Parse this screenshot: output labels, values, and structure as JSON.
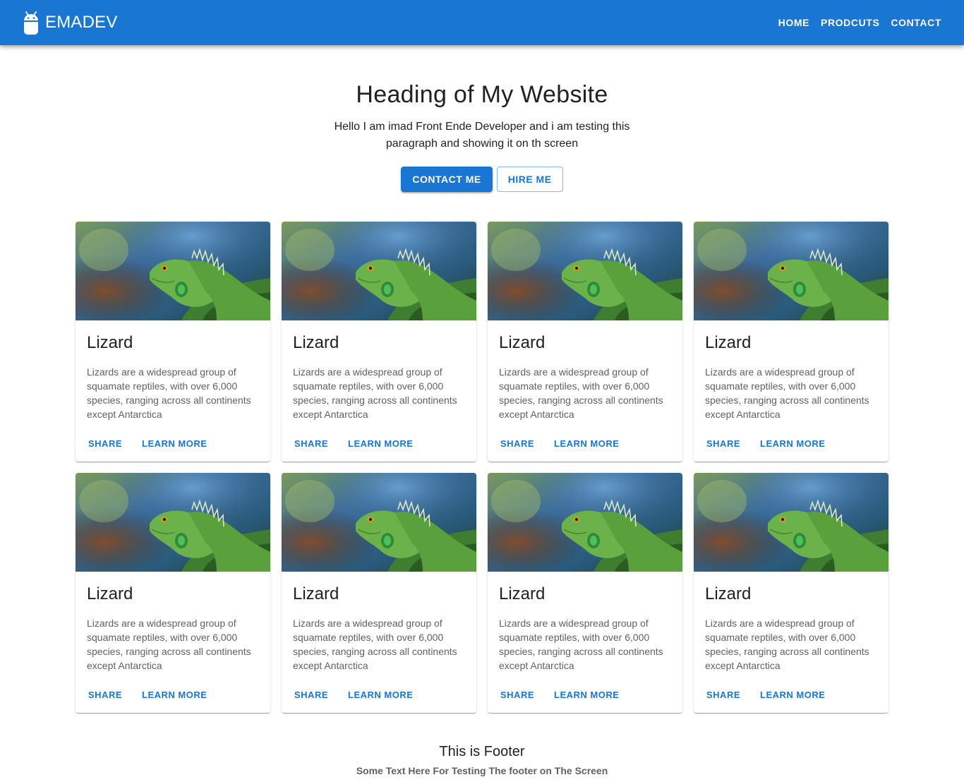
{
  "appbar": {
    "brand": "EMADEV",
    "brand_icon": "android-icon",
    "color": "#1976d2",
    "nav": [
      "HOME",
      "PRODCUTS",
      "CONTACT"
    ]
  },
  "hero": {
    "title": "Heading of My Website",
    "paragraph": "Hello I am imad Front Ende Developer and i am testing this paragraph and showing it on th screen",
    "primary_button": "CONTACT ME",
    "secondary_button": "HIRE ME"
  },
  "cards": [
    {
      "title": "Lizard",
      "text": "Lizards are a widespread group of squamate reptiles, with over 6,000 species, ranging across all continents except Antarctica",
      "share": "SHARE",
      "learn": "LEARN MORE",
      "image": "lizard-photo"
    },
    {
      "title": "Lizard",
      "text": "Lizards are a widespread group of squamate reptiles, with over 6,000 species, ranging across all continents except Antarctica",
      "share": "SHARE",
      "learn": "LEARN MORE",
      "image": "lizard-photo"
    },
    {
      "title": "Lizard",
      "text": "Lizards are a widespread group of squamate reptiles, with over 6,000 species, ranging across all continents except Antarctica",
      "share": "SHARE",
      "learn": "LEARN MORE",
      "image": "lizard-photo"
    },
    {
      "title": "Lizard",
      "text": "Lizards are a widespread group of squamate reptiles, with over 6,000 species, ranging across all continents except Antarctica",
      "share": "SHARE",
      "learn": "LEARN MORE",
      "image": "lizard-photo"
    },
    {
      "title": "Lizard",
      "text": "Lizards are a widespread group of squamate reptiles, with over 6,000 species, ranging across all continents except Antarctica",
      "share": "SHARE",
      "learn": "LEARN MORE",
      "image": "lizard-photo"
    },
    {
      "title": "Lizard",
      "text": "Lizards are a widespread group of squamate reptiles, with over 6,000 species, ranging across all continents except Antarctica",
      "share": "SHARE",
      "learn": "LEARN MORE",
      "image": "lizard-photo"
    },
    {
      "title": "Lizard",
      "text": "Lizards are a widespread group of squamate reptiles, with over 6,000 species, ranging across all continents except Antarctica",
      "share": "SHARE",
      "learn": "LEARN MORE",
      "image": "lizard-photo"
    },
    {
      "title": "Lizard",
      "text": "Lizards are a widespread group of squamate reptiles, with over 6,000 species, ranging across all continents except Antarctica",
      "share": "SHARE",
      "learn": "LEARN MORE",
      "image": "lizard-photo"
    }
  ],
  "footer": {
    "title": "This is Footer",
    "text": "Some Text Here For Testing The footer on The Screen"
  }
}
